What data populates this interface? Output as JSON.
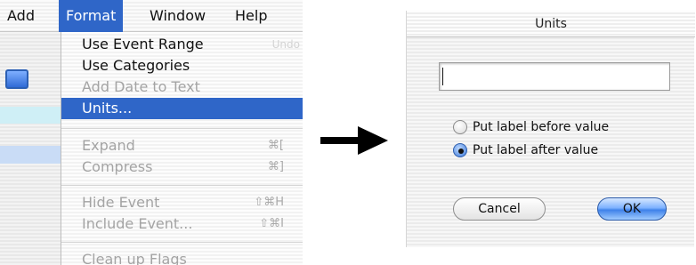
{
  "menubar": {
    "items": [
      "Add",
      "Format",
      "Window",
      "Help"
    ],
    "active_index": 1
  },
  "format_menu": {
    "items": [
      {
        "label": "Use Event Range",
        "enabled": true,
        "selected": false,
        "shortcut": "",
        "trailing": "Undo"
      },
      {
        "label": "Use Categories",
        "enabled": true,
        "selected": false,
        "shortcut": "",
        "trailing": ""
      },
      {
        "label": "Add Date to Text",
        "enabled": false,
        "selected": false,
        "shortcut": "",
        "trailing": ""
      },
      {
        "label": "Units...",
        "enabled": true,
        "selected": true,
        "shortcut": "",
        "trailing": ""
      },
      {
        "label": "Expand",
        "enabled": false,
        "selected": false,
        "shortcut": "⌘[",
        "trailing": ""
      },
      {
        "label": "Compress",
        "enabled": false,
        "selected": false,
        "shortcut": "⌘]",
        "trailing": ""
      },
      {
        "label": "Hide Event",
        "enabled": false,
        "selected": false,
        "shortcut": "⇧⌘H",
        "trailing": ""
      },
      {
        "label": "Include Event...",
        "enabled": false,
        "selected": false,
        "shortcut": "⇧⌘I",
        "trailing": ""
      },
      {
        "label": "Clean up Flags",
        "enabled": false,
        "selected": false,
        "shortcut": "",
        "trailing": ""
      }
    ]
  },
  "dialog": {
    "title": "Units",
    "units_value": "",
    "radio_before_label": "Put label before value",
    "radio_after_label": "Put label after value",
    "selected_option": "after",
    "cancel_label": "Cancel",
    "ok_label": "OK"
  },
  "icons": {
    "app": "app-window-icon",
    "arrow": "right-arrow-icon"
  },
  "colors": {
    "highlight": "#2f66c8",
    "disabled_text": "#a4a4a4",
    "default_button": "#3f82ea"
  }
}
